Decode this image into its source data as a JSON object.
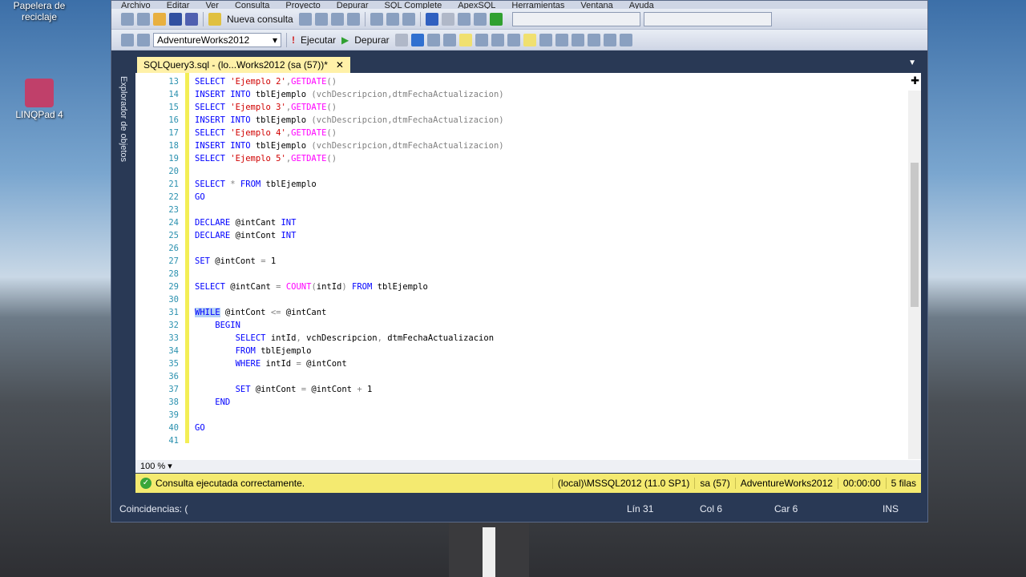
{
  "desktop": {
    "recycle": "Papelera de reciclaje",
    "linqpad": "LINQPad 4"
  },
  "menu": [
    "Archivo",
    "Editar",
    "Ver",
    "Consulta",
    "Proyecto",
    "Depurar",
    "SQL Complete",
    "ApexSQL",
    "Herramientas",
    "Ventana",
    "Ayuda"
  ],
  "toolbar": {
    "new_query": "Nueva consulta",
    "database": "AdventureWorks2012",
    "execute": "Ejecutar",
    "debug": "Depurar"
  },
  "tab": {
    "title": "SQLQuery3.sql - (lo...Works2012 (sa (57))*",
    "close": "✕"
  },
  "object_explorer": "Explorador de objetos",
  "code": [
    {
      "n": "13",
      "t": [
        [
          "SELECT ",
          "k"
        ],
        [
          "'Ejemplo 2'",
          "s"
        ],
        [
          ",",
          "g"
        ],
        [
          "GETDATE",
          "f"
        ],
        [
          "()",
          "g"
        ]
      ]
    },
    {
      "n": "14",
      "t": [
        [
          "INSERT INTO ",
          "k"
        ],
        [
          "tblEjemplo ",
          "p"
        ],
        [
          "(vchDescripcion,dtmFechaActualizacion)",
          "g"
        ]
      ]
    },
    {
      "n": "15",
      "t": [
        [
          "SELECT ",
          "k"
        ],
        [
          "'Ejemplo 3'",
          "s"
        ],
        [
          ",",
          "g"
        ],
        [
          "GETDATE",
          "f"
        ],
        [
          "()",
          "g"
        ]
      ]
    },
    {
      "n": "16",
      "t": [
        [
          "INSERT INTO ",
          "k"
        ],
        [
          "tblEjemplo ",
          "p"
        ],
        [
          "(vchDescripcion,dtmFechaActualizacion)",
          "g"
        ]
      ]
    },
    {
      "n": "17",
      "t": [
        [
          "SELECT ",
          "k"
        ],
        [
          "'Ejemplo 4'",
          "s"
        ],
        [
          ",",
          "g"
        ],
        [
          "GETDATE",
          "f"
        ],
        [
          "()",
          "g"
        ]
      ]
    },
    {
      "n": "18",
      "t": [
        [
          "INSERT INTO ",
          "k"
        ],
        [
          "tblEjemplo ",
          "p"
        ],
        [
          "(vchDescripcion,dtmFechaActualizacion)",
          "g"
        ]
      ]
    },
    {
      "n": "19",
      "t": [
        [
          "SELECT ",
          "k"
        ],
        [
          "'Ejemplo 5'",
          "s"
        ],
        [
          ",",
          "g"
        ],
        [
          "GETDATE",
          "f"
        ],
        [
          "()",
          "g"
        ]
      ]
    },
    {
      "n": "20",
      "t": []
    },
    {
      "n": "21",
      "t": [
        [
          "SELECT ",
          "k"
        ],
        [
          "* ",
          "g"
        ],
        [
          "FROM ",
          "k"
        ],
        [
          "tblEjemplo",
          "p"
        ]
      ]
    },
    {
      "n": "22",
      "t": [
        [
          "GO",
          "k"
        ]
      ]
    },
    {
      "n": "23",
      "t": []
    },
    {
      "n": "24",
      "t": [
        [
          "DECLARE ",
          "k"
        ],
        [
          "@intCant ",
          "p"
        ],
        [
          "INT",
          "k"
        ]
      ]
    },
    {
      "n": "25",
      "t": [
        [
          "DECLARE ",
          "k"
        ],
        [
          "@intCont ",
          "p"
        ],
        [
          "INT",
          "k"
        ]
      ]
    },
    {
      "n": "26",
      "t": []
    },
    {
      "n": "27",
      "t": [
        [
          "SET ",
          "k"
        ],
        [
          "@intCont ",
          "p"
        ],
        [
          "= ",
          "g"
        ],
        [
          "1",
          "p"
        ]
      ]
    },
    {
      "n": "28",
      "t": []
    },
    {
      "n": "29",
      "t": [
        [
          "SELECT ",
          "k"
        ],
        [
          "@intCant ",
          "p"
        ],
        [
          "= ",
          "g"
        ],
        [
          "COUNT",
          "f"
        ],
        [
          "(",
          "g"
        ],
        [
          "intId",
          "p"
        ],
        [
          ") ",
          "g"
        ],
        [
          "FROM ",
          "k"
        ],
        [
          "tblEjemplo",
          "p"
        ]
      ]
    },
    {
      "n": "30",
      "t": []
    },
    {
      "n": "31",
      "t": [
        [
          "WHILE",
          "k sel"
        ],
        [
          " @intCont ",
          "p"
        ],
        [
          "<= ",
          "g"
        ],
        [
          "@intCant",
          "p"
        ]
      ]
    },
    {
      "n": "32",
      "t": [
        [
          "    BEGIN",
          "k"
        ]
      ]
    },
    {
      "n": "33",
      "t": [
        [
          "        SELECT ",
          "k"
        ],
        [
          "intId",
          "p"
        ],
        [
          ", ",
          "g"
        ],
        [
          "vchDescripcion",
          "p"
        ],
        [
          ", ",
          "g"
        ],
        [
          "dtmFechaActualizacion",
          "p"
        ]
      ]
    },
    {
      "n": "34",
      "t": [
        [
          "        FROM ",
          "k"
        ],
        [
          "tblEjemplo",
          "p"
        ]
      ]
    },
    {
      "n": "35",
      "t": [
        [
          "        WHERE ",
          "k"
        ],
        [
          "intId ",
          "p"
        ],
        [
          "= ",
          "g"
        ],
        [
          "@intCont",
          "p"
        ]
      ]
    },
    {
      "n": "36",
      "t": []
    },
    {
      "n": "37",
      "t": [
        [
          "        SET ",
          "k"
        ],
        [
          "@intCont ",
          "p"
        ],
        [
          "= ",
          "g"
        ],
        [
          "@intCont ",
          "p"
        ],
        [
          "+ ",
          "g"
        ],
        [
          "1",
          "p"
        ]
      ]
    },
    {
      "n": "38",
      "t": [
        [
          "    END",
          "k"
        ]
      ]
    },
    {
      "n": "39",
      "t": []
    },
    {
      "n": "40",
      "t": [
        [
          "GO",
          "k"
        ]
      ]
    },
    {
      "n": "41",
      "t": []
    }
  ],
  "zoom": "100 %",
  "status": {
    "message": "Consulta ejecutada correctamente.",
    "server": "(local)\\MSSQL2012 (11.0 SP1)",
    "user": "sa (57)",
    "db": "AdventureWorks2012",
    "time": "00:00:00",
    "rows": "5 filas"
  },
  "bottom": {
    "find": "Coincidencias: (",
    "line": "Lín 31",
    "col": "Col 6",
    "car": "Car 6",
    "mode": "INS"
  }
}
